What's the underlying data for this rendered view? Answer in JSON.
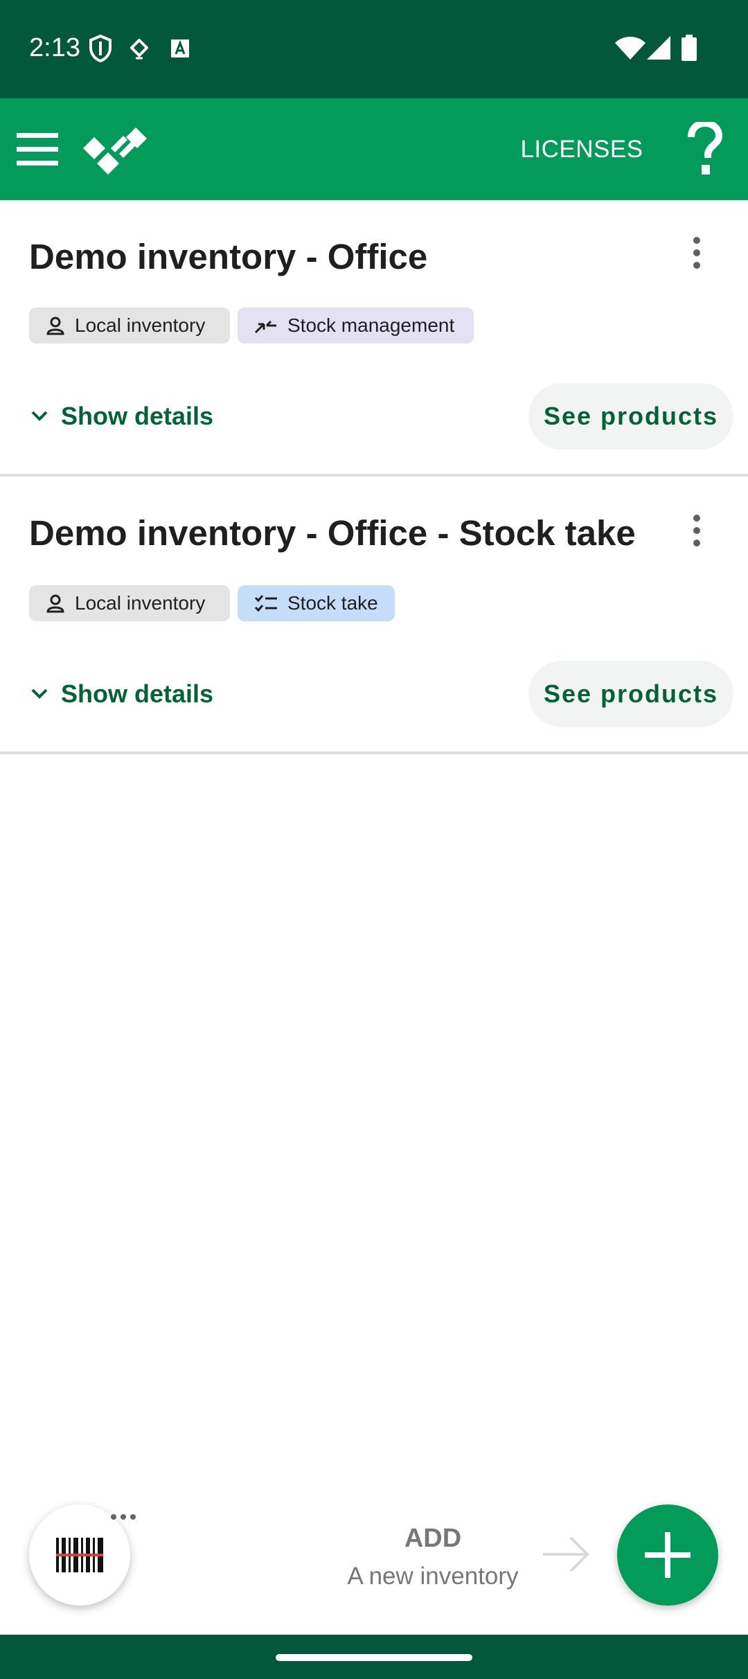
{
  "status_bar": {
    "time": "2:13",
    "icons": [
      "shield-icon",
      "nfc-icon",
      "text-a-icon",
      "wifi-icon",
      "signal-icon",
      "battery-icon"
    ]
  },
  "app_bar": {
    "licenses_label": "LICENSES",
    "icons": [
      "menu-icon",
      "app-logo-icon",
      "help-icon"
    ],
    "background_color": "#039b5a"
  },
  "inventories": [
    {
      "title": "Demo inventory - Office",
      "chips": [
        {
          "label": "Local inventory",
          "icon": "person-icon",
          "color": "#e4e4e4"
        },
        {
          "label": "Stock management",
          "icon": "merge-arrows-icon",
          "color": "#e3e1f2"
        }
      ],
      "show_details_label": "Show details",
      "see_products_label": "See products"
    },
    {
      "title": "Demo inventory - Office - Stock take",
      "chips": [
        {
          "label": "Local inventory",
          "icon": "person-icon",
          "color": "#e4e4e4"
        },
        {
          "label": "Stock take",
          "icon": "checklist-icon",
          "color": "#c6ddfa"
        }
      ],
      "show_details_label": "Show details",
      "see_products_label": "See products"
    }
  ],
  "bottom": {
    "add_label": "ADD",
    "add_sublabel": "A new inventory",
    "icons": [
      "barcode-scan-icon",
      "more-horizontal-icon",
      "arrow-right-icon",
      "plus-icon"
    ]
  }
}
